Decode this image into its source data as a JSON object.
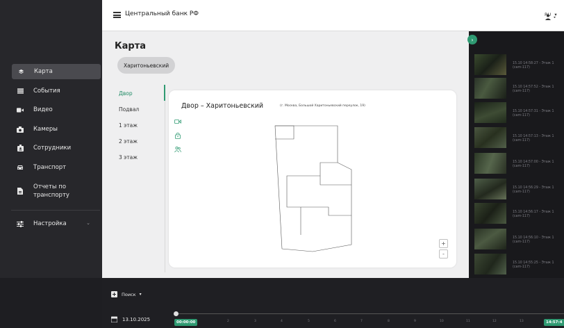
{
  "app": {
    "title": "Центральный банк РФ",
    "language": "RU"
  },
  "sidebar": {
    "items": [
      {
        "label": "Карта",
        "icon": "layers-icon",
        "active": true
      },
      {
        "label": "События",
        "icon": "list-icon"
      },
      {
        "label": "Видео",
        "icon": "video-icon"
      },
      {
        "label": "Камеры",
        "icon": "camera-icon"
      },
      {
        "label": "Сотрудники",
        "icon": "badge-icon"
      },
      {
        "label": "Транспорт",
        "icon": "car-icon"
      },
      {
        "label": "Отчеты по транспорту",
        "icon": "report-icon"
      },
      {
        "label": "Настройка",
        "icon": "sliders-icon"
      }
    ]
  },
  "main": {
    "title": "Карта",
    "chip": "Харитоньевский",
    "floors": [
      "Двор",
      "Подвал",
      "1 этаж",
      "2 этаж",
      "3 этаж"
    ],
    "active_floor": "Двор",
    "map": {
      "title": "Двор – Харитоньевский",
      "address": "(г. Москва, Большой Харитоньевский переулок, 19)",
      "zoom_in": "+",
      "zoom_out": "-"
    }
  },
  "events": [
    {
      "time": "15.10 14:58:27 - Этаж 1",
      "camera": "(cam-117)"
    },
    {
      "time": "15.10 14:57:52 - Этаж 1",
      "camera": "(cam-117)"
    },
    {
      "time": "15.10 14:57:31 - Этаж 1",
      "camera": "(cam-117)"
    },
    {
      "time": "15.10 14:57:13 - Этаж 1",
      "camera": "(cam-117)"
    },
    {
      "time": "15.10 14:57:00 - Этаж 1",
      "camera": "(cam-117)"
    },
    {
      "time": "15.10 14:56:29 - Этаж 1",
      "camera": "(cam-117)"
    },
    {
      "time": "15.10 14:56:17 - Этаж 1",
      "camera": "(cam-117)"
    },
    {
      "time": "15.10 14:56:10 - Этаж 1",
      "camera": "(cam-117)"
    },
    {
      "time": "15.10 14:55:25 - Этаж 1",
      "camera": "(cam-117)"
    }
  ],
  "bottom": {
    "search_label": "Поиск",
    "date": "13.10.2025",
    "start_time": "00:00:00",
    "current_time": "14:57:4",
    "hour_ticks": [
      "1",
      "2",
      "3",
      "4",
      "5",
      "6",
      "7",
      "8",
      "9",
      "10",
      "11",
      "12",
      "13"
    ]
  },
  "colors": {
    "accent": "#2f9a72",
    "sidebar": "#27272b",
    "panel": "#19191c"
  }
}
